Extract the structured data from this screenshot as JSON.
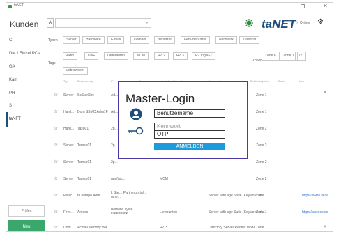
{
  "window": {
    "title": "taNFT",
    "min_icon": "minimize-icon",
    "close_icon": "close-icon",
    "close_glyph": "✕"
  },
  "header": {
    "page_title": "Kunden",
    "filter_all": "A",
    "search_value": "",
    "search_chevron": "»",
    "logo_text": "taNET",
    "status": "☉ Online",
    "gear_glyph": "⚙"
  },
  "sidebar": {
    "items": [
      {
        "label": "C"
      },
      {
        "label": "Div. / Einzel PCs"
      },
      {
        "label": "GA"
      },
      {
        "label": "Kam"
      },
      {
        "label": "PH"
      },
      {
        "label": "S"
      },
      {
        "label": "taNFT"
      }
    ],
    "pruefen_label": "Prüfen",
    "neu_label": "Neu"
  },
  "filters": {
    "typen_label": "Typen",
    "typen_chips": [
      "Server",
      "Hardware",
      "E-mail",
      "Domain",
      "Benutzer",
      "Fern-Benutzer",
      "Netzwerk",
      "Zertifikat"
    ],
    "tags_label": "Tags",
    "tags_chips": [
      "Aktiv",
      "DNF",
      "Lieferanten",
      "MCM",
      "RZ 2",
      "RZ 3",
      "RZ ingNFT"
    ],
    "tags_chips_row2": [
      "ueberwacht"
    ],
    "zonen_label": "Zonen",
    "zonen_chips": [
      "Zone 6",
      "Zone 1",
      "7Z"
    ]
  },
  "table": {
    "headers": [
      "Typ",
      "Bezeichnung",
      "IP",
      "Typ",
      "Hersteller / Modell",
      "Beschreibung",
      "Betriebssystem",
      "Zone",
      "Link"
    ],
    "rows": [
      {
        "type": "Server",
        "name": "ScStarSbe",
        "c3": "Ad...",
        "c4": "",
        "c5": "",
        "zone": "Zone 1",
        "link": ""
      },
      {
        "type": "Hard...",
        "name": "Dom SSMC Adm1F",
        "c3": "Ad...",
        "c4": "",
        "c5": "",
        "zone": "Zone 1",
        "link": ""
      },
      {
        "type": "Hard...",
        "name": "Taso01",
        "c3": "2p...",
        "c4": "",
        "c5": "",
        "zone": "Zone 2",
        "link": ""
      },
      {
        "type": "Server",
        "name": "Tsmsp01",
        "c3": "2p...",
        "c4": "",
        "c5": "",
        "zone": "Zone 2",
        "link": ""
      },
      {
        "type": "Server",
        "name": "Tsmsp01",
        "c3": "2p...",
        "c4": "",
        "c5": "",
        "zone": "Zone 2",
        "link": ""
      },
      {
        "type": "Server",
        "name": "Tsmsp01",
        "c3": "ups/tak...",
        "c4": "MCM",
        "c5": "",
        "zone": "Zone 2",
        "link": ""
      },
      {
        "type": "Peter...",
        "name": "ta ontapo Adm",
        "c3": "L Ste… Partnerportal… ame...",
        "c4": "",
        "c5": "Server with age Suite (Keyword: st...",
        "zone": "Zone 1",
        "link": "https://www.ta.de"
      },
      {
        "type": "Firm...",
        "name": "Arcess",
        "c3": "Betriebs syste… Datenbank…",
        "c4": "Lieferanten",
        "c5": "Server with age Suite (Keyword: st...",
        "zone": "Zone 1",
        "link": "https://access.de"
      },
      {
        "type": "Dom...",
        "name": "ActiveDirectory Wa",
        "c3": "",
        "c4": "RZ 3",
        "c5": "Directory Server Redest Mode",
        "zone": "Zone 1",
        "link": ""
      }
    ]
  },
  "login": {
    "title": "Master-Login",
    "username_value": "Benutzername",
    "password_placeholder": "Kennwort",
    "otp_value": "OTP",
    "submit_label": "ANMELDEN"
  },
  "colors": {
    "accent": "#1f4e7a",
    "modal_border": "#4a3aa8",
    "submit": "#1e9bd8",
    "neu_button": "#3aa86c"
  }
}
